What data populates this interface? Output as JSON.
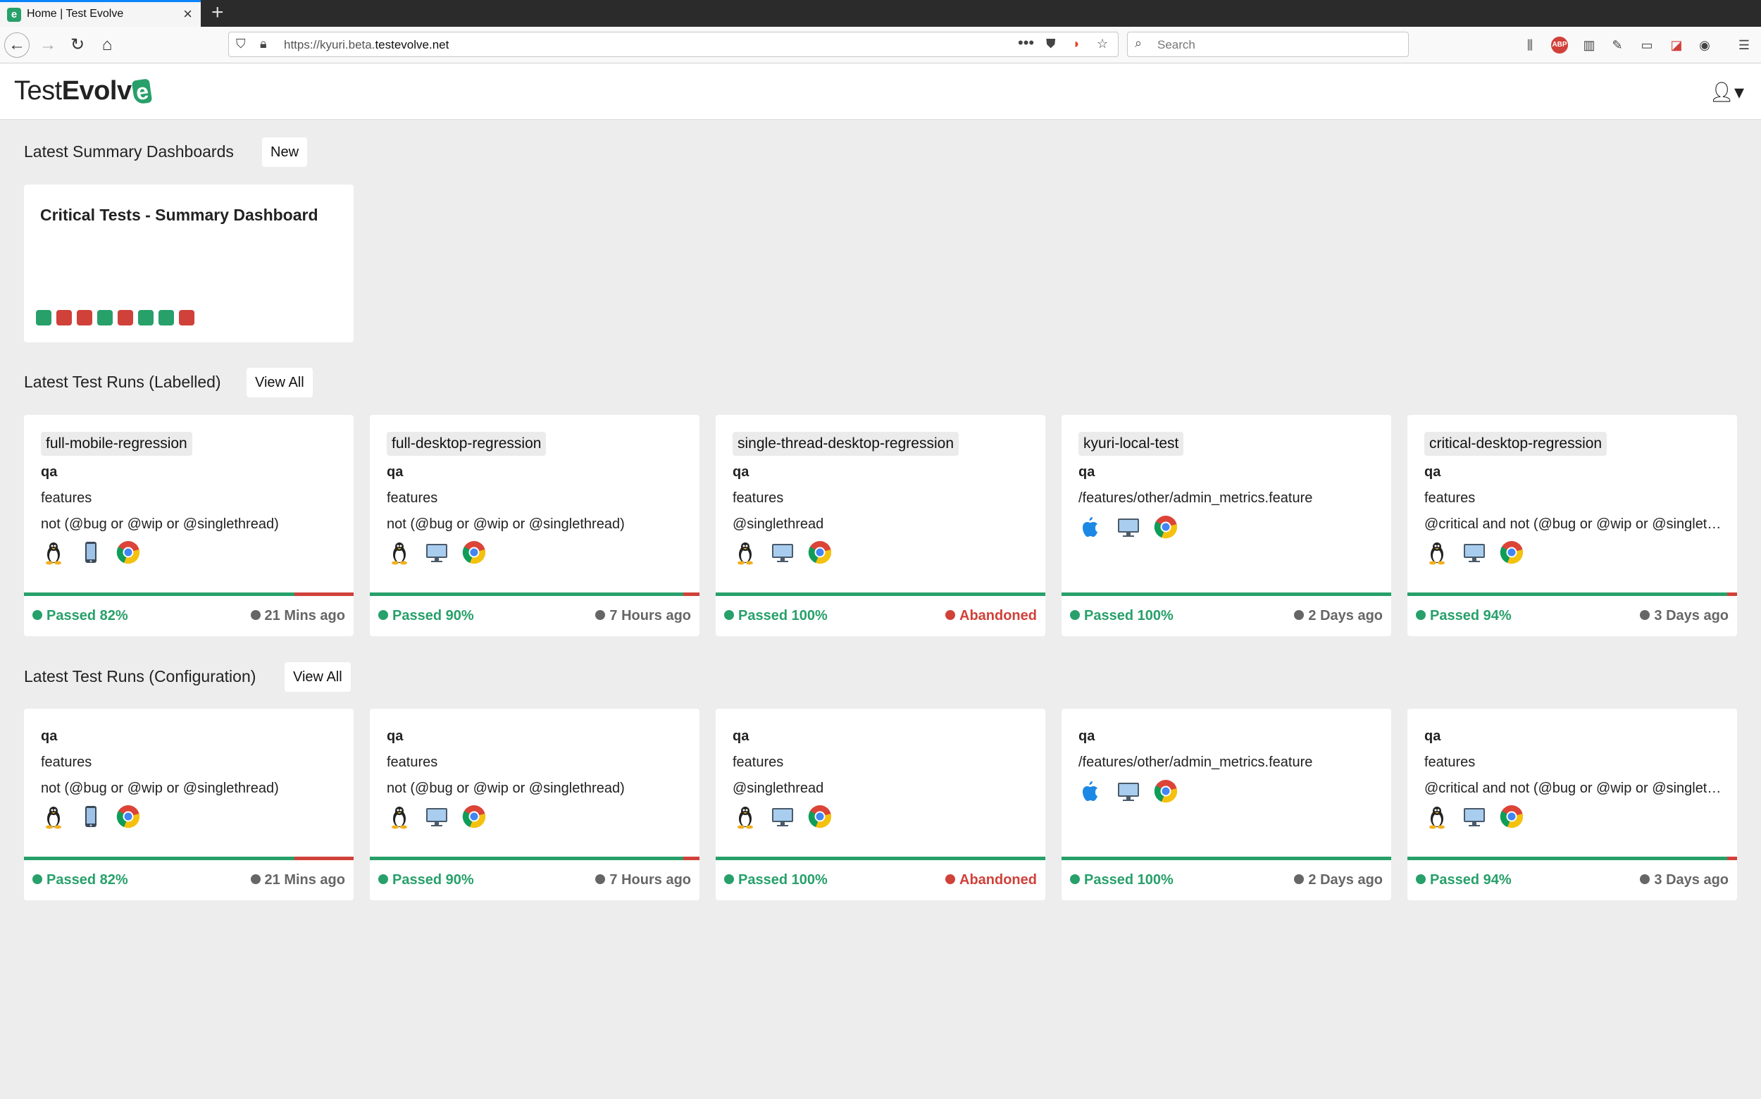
{
  "browser": {
    "tab_title": "Home | Test Evolve",
    "tab_favicon": "e",
    "url_prefix": "https://kyuri.beta.",
    "url_domain": "testevolve.net",
    "search_placeholder": "Search"
  },
  "app": {
    "logo_light": "Test",
    "logo_bold": "Evolv",
    "logo_mark": "e"
  },
  "summary": {
    "title": "Latest Summary Dashboards",
    "new_label": "New",
    "dashboard": {
      "title": "Critical Tests - Summary Dashboard",
      "squares": [
        "pass",
        "fail",
        "fail",
        "pass",
        "fail",
        "pass",
        "pass",
        "fail"
      ]
    }
  },
  "colors": {
    "pass": "#27a06a",
    "fail": "#d0413a"
  },
  "labelled": {
    "title": "Latest Test Runs (Labelled)",
    "view_all": "View All",
    "cards": [
      {
        "label": "full-mobile-regression",
        "env": "qa",
        "path": "features",
        "tags": "not (@bug or @wip or @singlethread)",
        "icons": [
          "linux",
          "mobile",
          "chrome"
        ],
        "status": "Passed 82%",
        "pass_pct": 82,
        "time": "21 Mins ago",
        "abandoned": false
      },
      {
        "label": "full-desktop-regression",
        "env": "qa",
        "path": "features",
        "tags": "not (@bug or @wip or @singlethread)",
        "icons": [
          "linux",
          "desktop",
          "chrome"
        ],
        "status": "Passed 90%",
        "pass_pct": 95,
        "time": "7 Hours ago",
        "abandoned": false
      },
      {
        "label": "single-thread-desktop-regression",
        "env": "qa",
        "path": "features",
        "tags": "@singlethread",
        "icons": [
          "linux",
          "desktop",
          "chrome"
        ],
        "status": "Passed 100%",
        "pass_pct": 100,
        "time": "Abandoned",
        "abandoned": true
      },
      {
        "label": "kyuri-local-test",
        "env": "qa",
        "path": "/features/other/admin_metrics.feature",
        "tags": "",
        "icons": [
          "apple",
          "desktop",
          "chrome"
        ],
        "status": "Passed 100%",
        "pass_pct": 100,
        "time": "2 Days ago",
        "abandoned": false
      },
      {
        "label": "critical-desktop-regression",
        "env": "qa",
        "path": "features",
        "tags": "@critical and not (@bug or @wip or @singlet…",
        "icons": [
          "linux",
          "desktop",
          "chrome"
        ],
        "status": "Passed 94%",
        "pass_pct": 97,
        "time": "3 Days ago",
        "abandoned": false
      }
    ]
  },
  "configuration": {
    "title": "Latest Test Runs (Configuration)",
    "view_all": "View All",
    "cards": [
      {
        "env": "qa",
        "path": "features",
        "tags": "not (@bug or @wip or @singlethread)",
        "icons": [
          "linux",
          "mobile",
          "chrome"
        ],
        "status": "Passed 82%",
        "pass_pct": 82,
        "time": "21 Mins ago",
        "abandoned": false
      },
      {
        "env": "qa",
        "path": "features",
        "tags": "not (@bug or @wip or @singlethread)",
        "icons": [
          "linux",
          "desktop",
          "chrome"
        ],
        "status": "Passed 90%",
        "pass_pct": 95,
        "time": "7 Hours ago",
        "abandoned": false
      },
      {
        "env": "qa",
        "path": "features",
        "tags": "@singlethread",
        "icons": [
          "linux",
          "desktop",
          "chrome"
        ],
        "status": "Passed 100%",
        "pass_pct": 100,
        "time": "Abandoned",
        "abandoned": true
      },
      {
        "env": "qa",
        "path": "/features/other/admin_metrics.feature",
        "tags": "",
        "icons": [
          "apple",
          "desktop",
          "chrome"
        ],
        "status": "Passed 100%",
        "pass_pct": 100,
        "time": "2 Days ago",
        "abandoned": false
      },
      {
        "env": "qa",
        "path": "features",
        "tags": "@critical and not (@bug or @wip or @singlet…",
        "icons": [
          "linux",
          "desktop",
          "chrome"
        ],
        "status": "Passed 94%",
        "pass_pct": 97,
        "time": "3 Days ago",
        "abandoned": false
      }
    ]
  }
}
